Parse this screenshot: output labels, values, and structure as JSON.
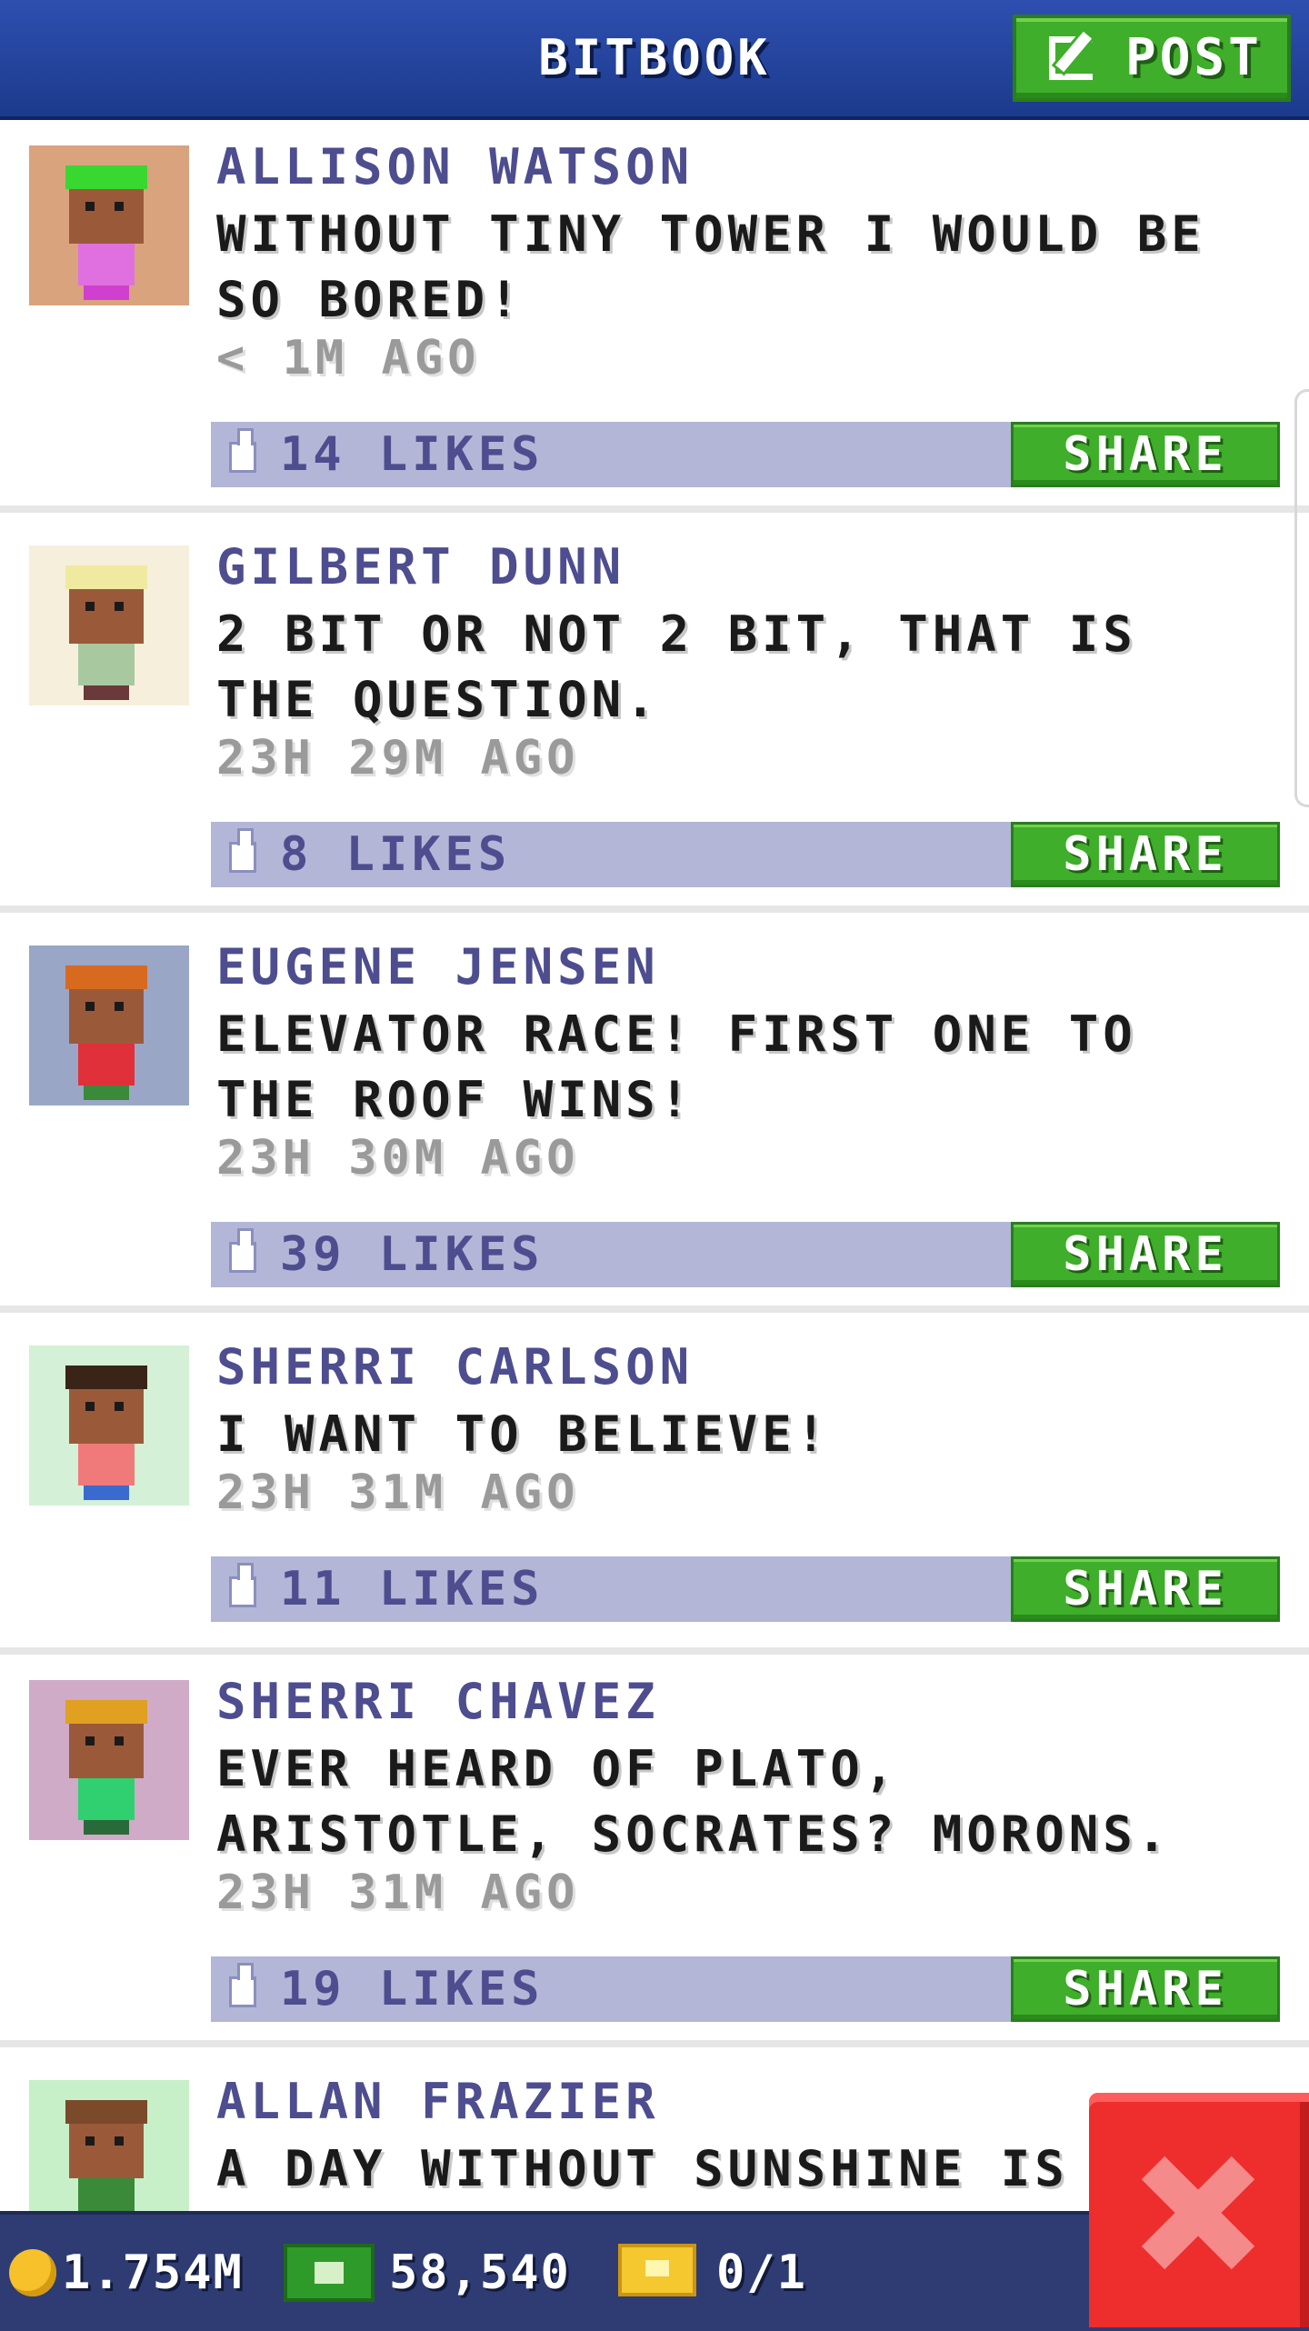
{
  "header": {
    "title": "BITBOOK",
    "post_label": "POST"
  },
  "posts": [
    {
      "author": "ALLISON WATSON",
      "message": "WITHOUT TINY TOWER I WOULD BE SO BORED!",
      "time": "< 1M AGO",
      "likes": "14 LIKES",
      "share_label": "SHARE"
    },
    {
      "author": "GILBERT DUNN",
      "message": "2 BIT OR NOT 2 BIT, THAT IS THE QUESTION.",
      "time": "23H 29M AGO",
      "likes": "8 LIKES",
      "share_label": "SHARE"
    },
    {
      "author": "EUGENE JENSEN",
      "message": "ELEVATOR RACE! FIRST ONE TO THE ROOF WINS!",
      "time": "23H 30M AGO",
      "likes": "39 LIKES",
      "share_label": "SHARE"
    },
    {
      "author": "SHERRI CARLSON",
      "message": "I WANT TO BELIEVE!",
      "time": "23H 31M AGO",
      "likes": "11 LIKES",
      "share_label": "SHARE"
    },
    {
      "author": "SHERRI CHAVEZ",
      "message": "EVER HEARD OF PLATO, ARISTOTLE, SOCRATES? MORONS.",
      "time": "23H 31M AGO",
      "likes": "19 LIKES",
      "share_label": "SHARE"
    },
    {
      "author": "ALLAN FRAZIER",
      "message": "A DAY WITHOUT SUNSHINE IS LIK"
    }
  ],
  "avatars": [
    {
      "bg": "#d9a37e",
      "hair": "#38d830",
      "shirt": "#e070e0",
      "legs": "#d040d0"
    },
    {
      "bg": "#f6efdc",
      "hair": "#f0eaa0",
      "shirt": "#a8c8a0",
      "legs": "#6a3a3a"
    },
    {
      "bg": "#9aa6c6",
      "hair": "#d86a20",
      "shirt": "#e0303a",
      "legs": "#3a8a3a"
    },
    {
      "bg": "#d4f0d6",
      "hair": "#3a2418",
      "shirt": "#f07a7a",
      "legs": "#3a6ad0"
    },
    {
      "bg": "#cfabc7",
      "hair": "#e0a020",
      "shirt": "#30d070",
      "legs": "#2a6a3a"
    },
    {
      "bg": "#c7f0c8",
      "hair": "#7a4a2a",
      "shirt": "#3a8a3a",
      "legs": "#2a5a2a"
    }
  ],
  "footer": {
    "coins": "1.754M",
    "bux": "58,540",
    "tickets": "0/1"
  },
  "icons": {
    "post": "edit-icon",
    "like": "thumb-icon",
    "coin": "coin-icon",
    "bux": "bux-icon",
    "ticket": "ticket-icon",
    "close": "close-icon"
  },
  "colors": {
    "header": "#2e4fb0",
    "button_green": "#3fae2a",
    "like_bar": "#b3b6d6",
    "close_red": "#ee2d2d",
    "footer": "#2e3c73"
  }
}
